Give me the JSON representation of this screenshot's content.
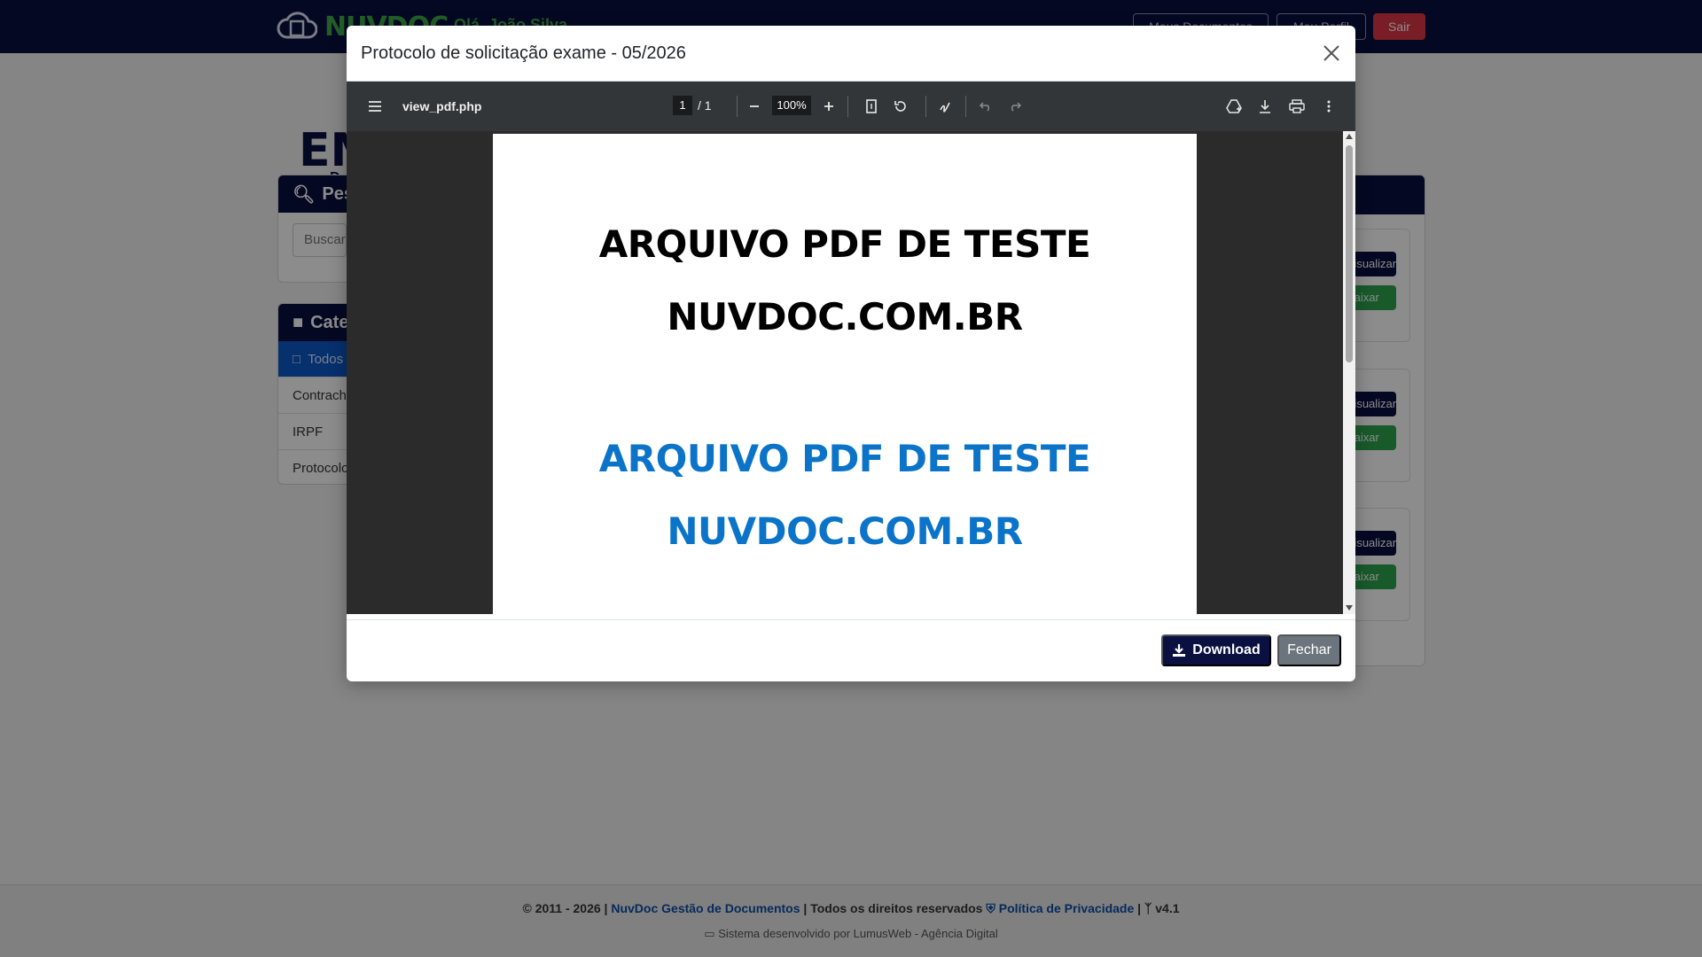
{
  "app": {
    "logo_text": "NUVDOC",
    "greeting": "Olá, João Silva",
    "nav": {
      "docs_label": "Meus Documentos",
      "profile_label": "Meu Perfil",
      "logout_label": "Sair"
    },
    "brand_big": "EM",
    "brand_sub": "D",
    "search": {
      "title": "Pesquisar",
      "placeholder": "Buscar"
    },
    "categories": {
      "title": "Categorias",
      "items": [
        "Todos",
        "Contracheque",
        "IRPF",
        "Protocolo"
      ]
    },
    "doc_buttons": {
      "view": "Visualizar",
      "download": "Baixar"
    }
  },
  "modal": {
    "title": "Protocolo de solicitação exame - 05/2026",
    "viewer": {
      "filename": "view_pdf.php",
      "current_page": "1",
      "total_pages": "/ 1",
      "zoom": "100%"
    },
    "pdf_content": {
      "line1": "ARQUIVO PDF DE TESTE",
      "line2": "NUVDOC.COM.BR",
      "line3": "ARQUIVO PDF DE TESTE",
      "line4": "NUVDOC.COM.BR"
    },
    "footer": {
      "download_label": "Download",
      "close_label": "Fechar"
    }
  },
  "footer": {
    "copyright": "© 2011 - 2026 |",
    "company_link": "NuvDoc Gestão de Documentos",
    "rights": "| Todos os direitos reservados",
    "privacy_link": "Política de Privacidade",
    "version": "v4.1",
    "developer": "Sistema desenvolvido por LumusWeb - Agência Digital"
  },
  "colors": {
    "navbar": "#0a1040",
    "brand_green": "#3fae4a",
    "pdf_blue": "#0b74c9",
    "danger": "#dc3545",
    "secondary": "#6c757d"
  }
}
